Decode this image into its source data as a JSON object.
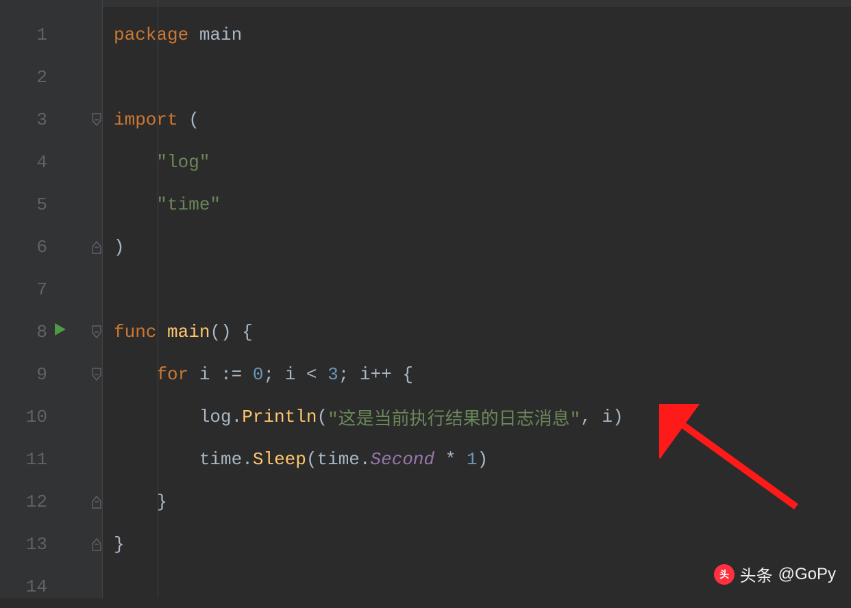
{
  "line_numbers": [
    "1",
    "2",
    "3",
    "4",
    "5",
    "6",
    "7",
    "8",
    "9",
    "10",
    "11",
    "12",
    "13",
    "14"
  ],
  "tokens": {
    "kw_package": "package",
    "ident_main": "main",
    "kw_import": "import",
    "str_log": "\"log\"",
    "str_time": "\"time\"",
    "kw_func": "func",
    "func_main": "main",
    "kw_for": "for",
    "ident_i": "i",
    "op_decl": ":=",
    "num_0": "0",
    "semi": ";",
    "op_lt": "<",
    "num_3": "3",
    "op_inc": "++",
    "lbrace": "{",
    "rbrace": "}",
    "lparen": "(",
    "rparen": ")",
    "ident_log": "log",
    "dot": ".",
    "func_println": "Println",
    "str_msg": "\"这是当前执行结果的日志消息\"",
    "comma": ",",
    "ident_time": "time",
    "func_sleep": "Sleep",
    "const_second": "Second",
    "op_mul": "*",
    "num_1": "1",
    "empty": ""
  },
  "watermark": {
    "label_prefix": "头条",
    "label_handle": "@GoPy"
  }
}
